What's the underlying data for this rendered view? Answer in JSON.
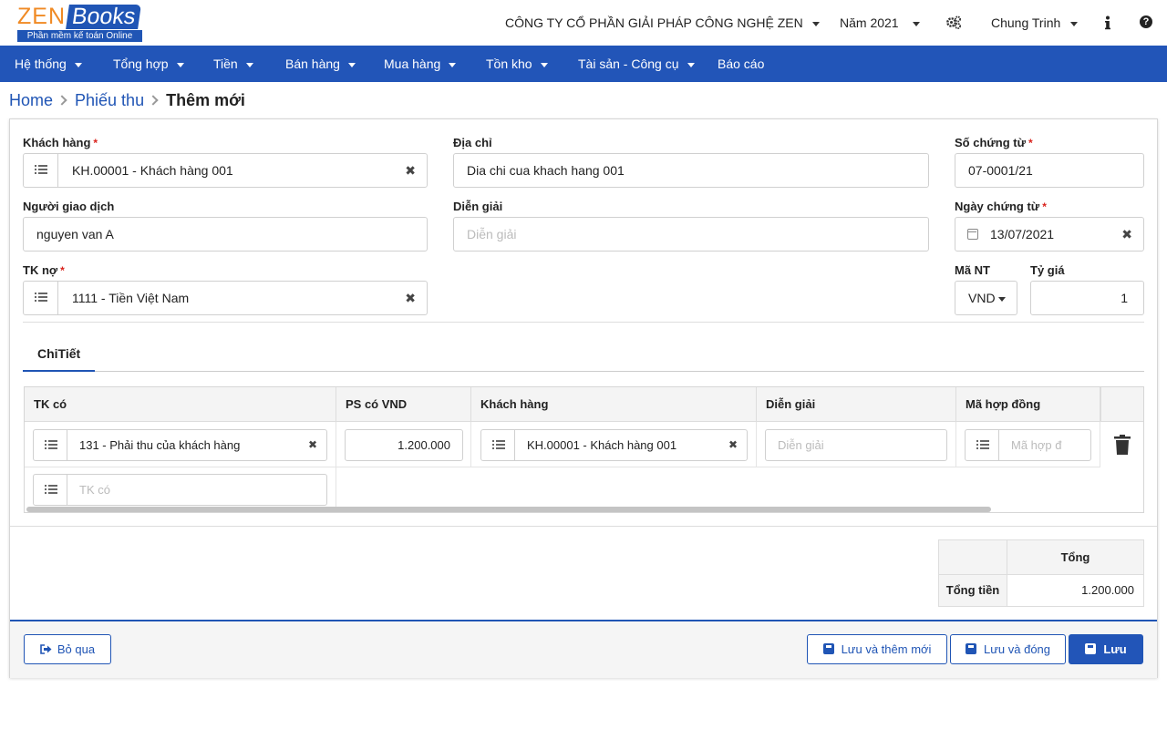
{
  "brand": {
    "zen": "ZEN",
    "books": "Books",
    "tagline": "Phần mềm kế toán Online",
    "accent": "#2055b5",
    "orange": "#f08a24"
  },
  "topbar": {
    "company": "CÔNG TY CỔ PHẦN GIẢI PHÁP CÔNG NGHỆ ZEN",
    "year": "Năm 2021",
    "user": "Chung Trinh",
    "icons": [
      "gears-icon",
      "info-icon",
      "help-icon"
    ]
  },
  "nav": [
    {
      "label": "Hệ thống"
    },
    {
      "label": "Tổng hợp"
    },
    {
      "label": "Tiền"
    },
    {
      "label": "Bán hàng"
    },
    {
      "label": "Mua hàng"
    },
    {
      "label": "Tồn kho"
    },
    {
      "label": "Tài sản - Công cụ"
    },
    {
      "label": "Báo cáo"
    }
  ],
  "breadcrumb": {
    "home": "Home",
    "parent": "Phiếu thu",
    "current": "Thêm mới"
  },
  "form": {
    "customer": {
      "label": "Khách hàng",
      "value": "KH.00001 - Khách hàng 001"
    },
    "address": {
      "label": "Địa chỉ",
      "value": "Dia chi cua khach hang 001"
    },
    "doc_no": {
      "label": "Số chứng từ",
      "value": "07-0001/21"
    },
    "trader": {
      "label": "Người giao dịch",
      "value": "nguyen van A"
    },
    "description": {
      "label": "Diễn giải",
      "placeholder": "Diễn giải"
    },
    "doc_date": {
      "label": "Ngày chứng từ",
      "value": "13/07/2021"
    },
    "debit_account": {
      "label": "TK nợ",
      "value": "1111 - Tiền Việt Nam"
    },
    "currency": {
      "label": "Mã NT",
      "value": "VND"
    },
    "rate": {
      "label": "Tỷ giá",
      "value": "1"
    },
    "required_mark": "*"
  },
  "tabs": {
    "detail": "ChiTiết"
  },
  "grid": {
    "headers": [
      "TK có",
      "PS có VND",
      "Khách hàng",
      "Diễn giải",
      "Mã hợp đồng"
    ],
    "row": {
      "account": "131 - Phải thu của khách hàng",
      "amount": "1.200.000",
      "customer": "KH.00001 - Khách hàng 001",
      "description_placeholder": "Diễn giải",
      "contract_placeholder": "Mã hợp đ"
    },
    "new_row_placeholder": "TK có"
  },
  "totals": {
    "header": "Tổng",
    "label": "Tổng tiền",
    "value": "1.200.000"
  },
  "footer": {
    "skip": "Bỏ qua",
    "save_new": "Lưu và thêm mới",
    "save_close": "Lưu và đóng",
    "save": "Lưu"
  }
}
